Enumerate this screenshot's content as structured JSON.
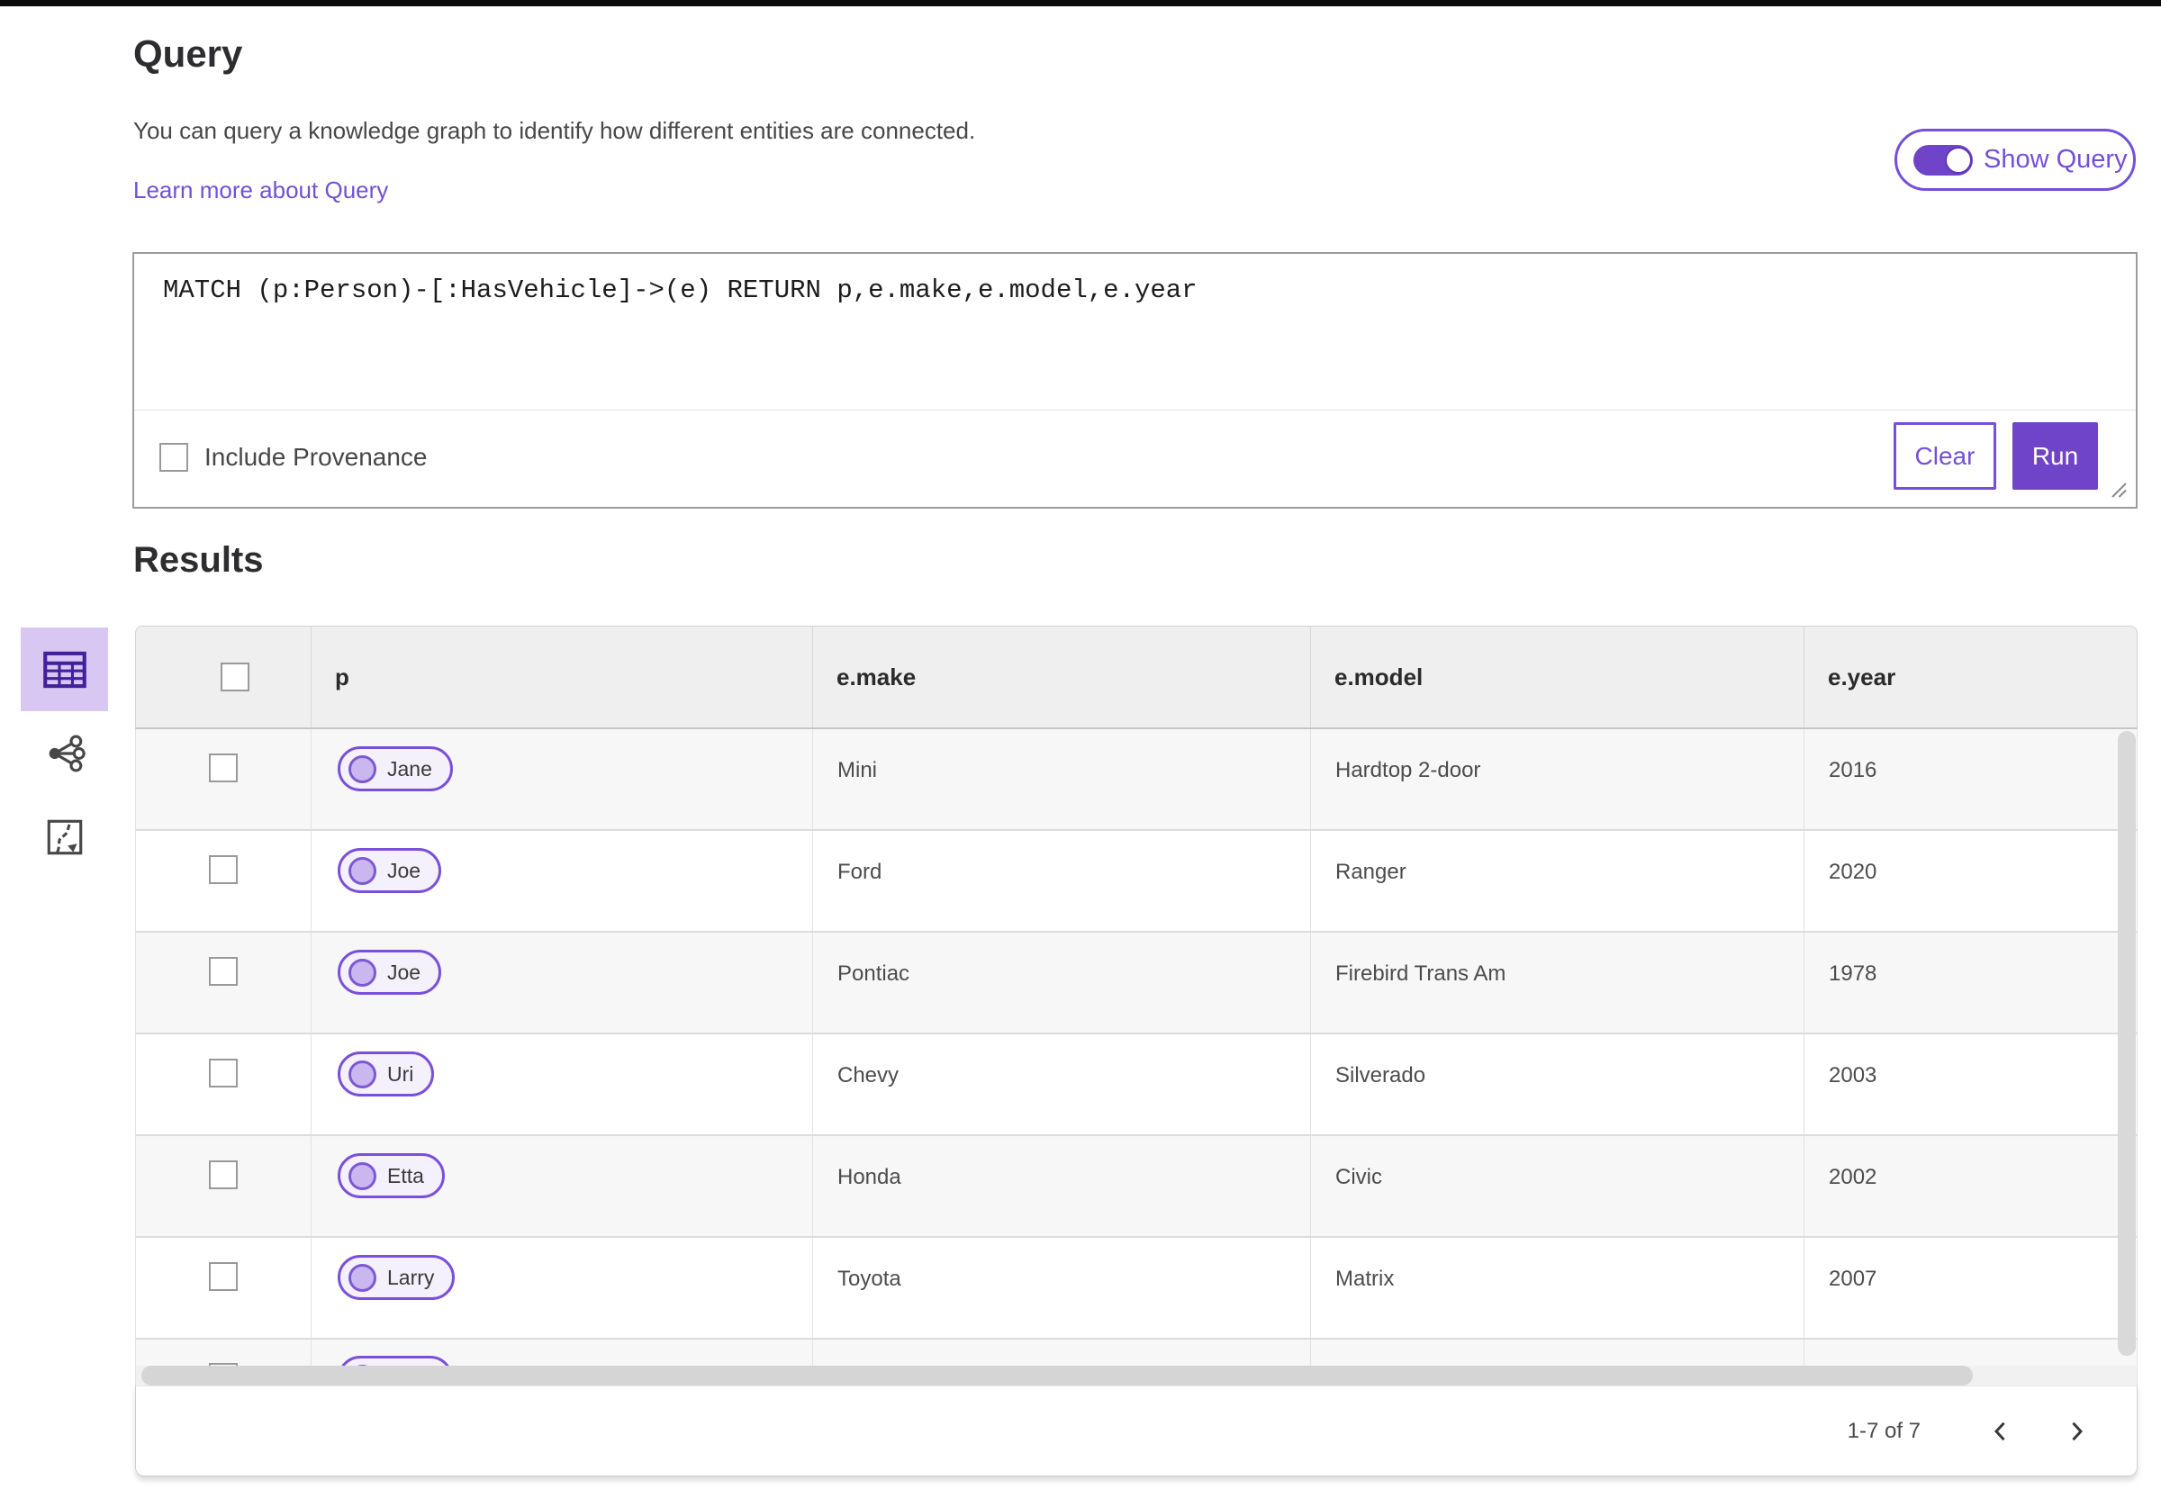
{
  "colors": {
    "accent_purple": "#6f44c8",
    "outline_purple": "#7450d8",
    "link_purple": "#7151d3",
    "chip_border": "#7a50da",
    "chip_bg": "#f4f1fc",
    "chip_circle_fill": "#cab7ef",
    "chip_circle_border": "#7e58d2",
    "selected_view_bg": "#d9c7f3",
    "table_header_bg": "#efeff0",
    "row_alt_bg": "#f7f7f8"
  },
  "query_panel": {
    "title": "Query",
    "description": "You can query a knowledge graph to identify how different entities are connected.",
    "learn_more_link": "Learn more about Query",
    "show_query_toggle": {
      "label": "Show Query",
      "state": "on"
    },
    "query_input": {
      "value": "MATCH (p:Person)-[:HasVehicle]->(e) RETURN p,e.make,e.model,e.year"
    },
    "include_provenance": {
      "label": "Include Provenance",
      "checked": false
    },
    "buttons": {
      "clear": "Clear",
      "run": "Run"
    }
  },
  "results_panel": {
    "title": "Results",
    "view_switcher": {
      "icons": [
        "table-view-icon",
        "link-chart-view-icon",
        "map-view-icon"
      ],
      "selected": "table-view-icon"
    },
    "table": {
      "columns": {
        "p": "p",
        "make": "e.make",
        "model": "e.model",
        "year": "e.year"
      },
      "rows": [
        {
          "p": "Jane",
          "make": "Mini",
          "model": "Hardtop 2-door",
          "year": "2016"
        },
        {
          "p": "Joe",
          "make": "Ford",
          "model": "Ranger",
          "year": "2020"
        },
        {
          "p": "Joe",
          "make": "Pontiac",
          "model": "Firebird Trans Am",
          "year": "1978"
        },
        {
          "p": "Uri",
          "make": "Chevy",
          "model": "Silverado",
          "year": "2003"
        },
        {
          "p": "Etta",
          "make": "Honda",
          "model": "Civic",
          "year": "2002"
        },
        {
          "p": "Larry",
          "make": "Toyota",
          "model": "Matrix",
          "year": "2007"
        }
      ],
      "partial_row_visible": true
    },
    "pagination": {
      "range": "1-7 of 7",
      "prev_icon": "chevron-left-icon",
      "next_icon": "chevron-right-icon"
    }
  }
}
